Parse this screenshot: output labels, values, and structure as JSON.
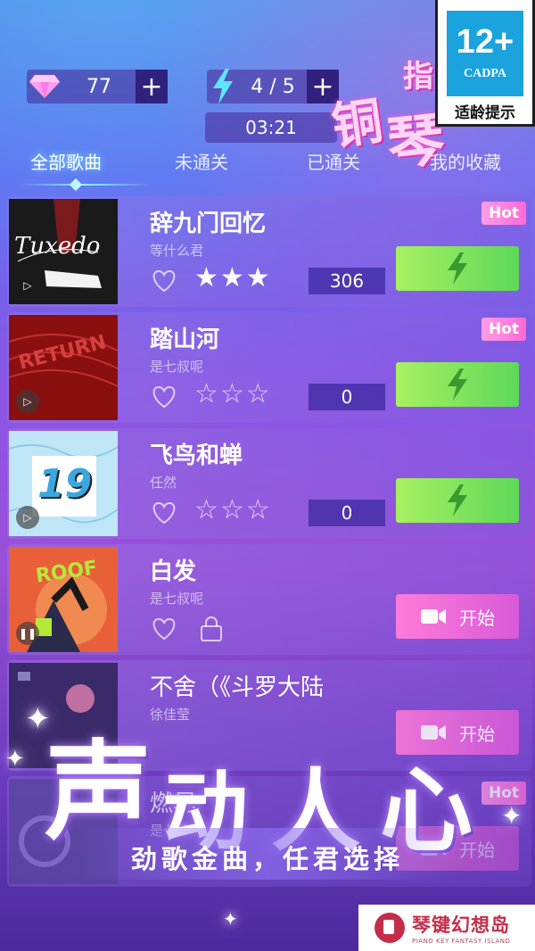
{
  "status": {
    "gems": "77",
    "energy": "4 / 5",
    "timer": "03:21",
    "plus_label": "+"
  },
  "banner": {
    "chars": [
      "指",
      "铜",
      "琴"
    ]
  },
  "age_rating": {
    "number": "12+",
    "org": "CADPA",
    "tip": "适龄提示"
  },
  "tabs": [
    {
      "label": "全部歌曲",
      "active": true
    },
    {
      "label": "未通关",
      "active": false
    },
    {
      "label": "已通关",
      "active": false
    },
    {
      "label": "我的收藏",
      "active": false
    }
  ],
  "songs": [
    {
      "title": "辞九门回忆",
      "artist": "等什么君",
      "stars": "★★★",
      "score": "306",
      "hot": "Hot",
      "action": "play",
      "cover_text": "Tuxedo"
    },
    {
      "title": "踏山河",
      "artist": "是七叔呢",
      "stars": "☆☆☆",
      "score": "0",
      "hot": "Hot",
      "action": "play",
      "cover_text": "RETURN"
    },
    {
      "title": "飞鸟和蝉",
      "artist": "任然",
      "stars": "☆☆☆",
      "score": "0",
      "hot": "",
      "action": "play",
      "cover_text": "19"
    },
    {
      "title": "白发",
      "artist": "是七叔呢",
      "stars": "",
      "score": "",
      "hot": "",
      "action": "start",
      "start_label": "开始",
      "cover_text": "ROOF"
    },
    {
      "title": "不舍（《斗罗大陆",
      "artist": "徐佳莹",
      "stars": "",
      "score": "",
      "hot": "",
      "action": "start",
      "start_label": "开始",
      "cover_text": ""
    },
    {
      "title": "燃尽",
      "artist": "是七叔呢",
      "stars": "",
      "score": "",
      "hot": "Hot",
      "action": "start",
      "start_label": "开始",
      "cover_text": ""
    }
  ],
  "slogan": {
    "big_chars": [
      "声",
      "动",
      "人",
      "心"
    ],
    "sub": "劲歌金曲，任君选择"
  },
  "logo": {
    "main": "琴键幻想岛",
    "sub": "PIANO KEY FANTASY ISLAND"
  },
  "colors": {
    "accent_green": "#5ed85a",
    "accent_pink": "#ff6ad6",
    "badge_blue": "#1aa3dc",
    "logo_red": "#c42d4a"
  }
}
